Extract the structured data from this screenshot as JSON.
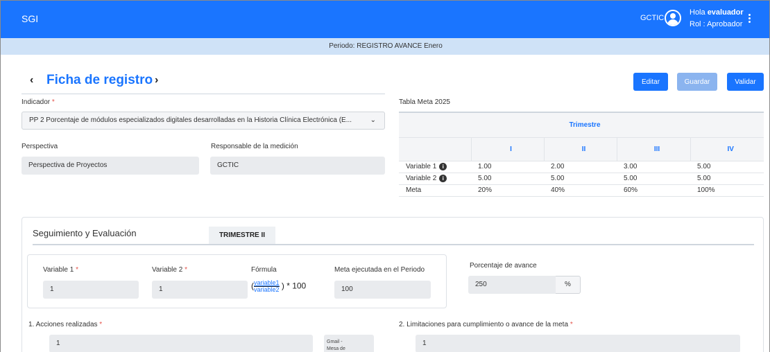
{
  "header": {
    "app_title": "SGI",
    "org": "GCTIC",
    "greeting_prefix": "Hola",
    "user_name": "evaluador",
    "role": "Rol : Aprobador"
  },
  "period": {
    "text": "Periodo: REGISTRO AVANCE Enero"
  },
  "page": {
    "title": "Ficha de registro",
    "prev_icon": "chevron-left-icon",
    "next_icon": "chevron-right-icon"
  },
  "actions": {
    "edit": "Editar",
    "save": "Guardar",
    "validate": "Validar"
  },
  "form": {
    "indicator_label": "Indicador",
    "indicator_value": "PP 2 Porcentaje de módulos especializados digitales desarrolladas en la Historia Clínica Electrónica (E...",
    "perspective_label": "Perspectiva",
    "perspective_value": "Perspectiva de Proyectos",
    "responsible_label": "Responsable de la medición",
    "responsible_value": "GCTIC"
  },
  "meta_table": {
    "title": "Tabla Meta 2025",
    "group_header": "Trimestre",
    "columns": [
      "I",
      "II",
      "III",
      "IV"
    ],
    "rows": [
      {
        "label": "Variable 1",
        "values": [
          "1.00",
          "2.00",
          "3.00",
          "5.00"
        ]
      },
      {
        "label": "Variable 2",
        "values": [
          "5.00",
          "5.00",
          "5.00",
          "5.00"
        ]
      },
      {
        "label": "Meta",
        "values": [
          "20%",
          "40%",
          "60%",
          "100%"
        ]
      }
    ]
  },
  "tracking": {
    "section_title": "Seguimiento y Evaluación",
    "active_tab": "TRIMESTRE II",
    "var1_label": "Variable 1",
    "var1_value": "1",
    "var2_label": "Variable 2",
    "var2_value": "1",
    "formula_label": "Fórmula",
    "formula_num": "variable1",
    "formula_den": "variable2",
    "formula_suffix": ") * 100",
    "formula_prefix": "(",
    "executed_label": "Meta ejecutada en el Periodo",
    "executed_value": "100",
    "progress_label": "Porcentaje de avance",
    "progress_value": "250",
    "progress_unit": "%",
    "actions_label": "1. Acciones realizadas",
    "actions_value": "1",
    "limits_label": "2. Limitaciones para cumplimiento o avance de la meta",
    "limits_value": "1",
    "side_note_line1": "Gmail -",
    "side_note_line2": "Mesa de"
  },
  "colors": {
    "primary": "#1a75ff",
    "period_bar": "#cfe2f7",
    "disabled_button": "#8bb4ef"
  }
}
